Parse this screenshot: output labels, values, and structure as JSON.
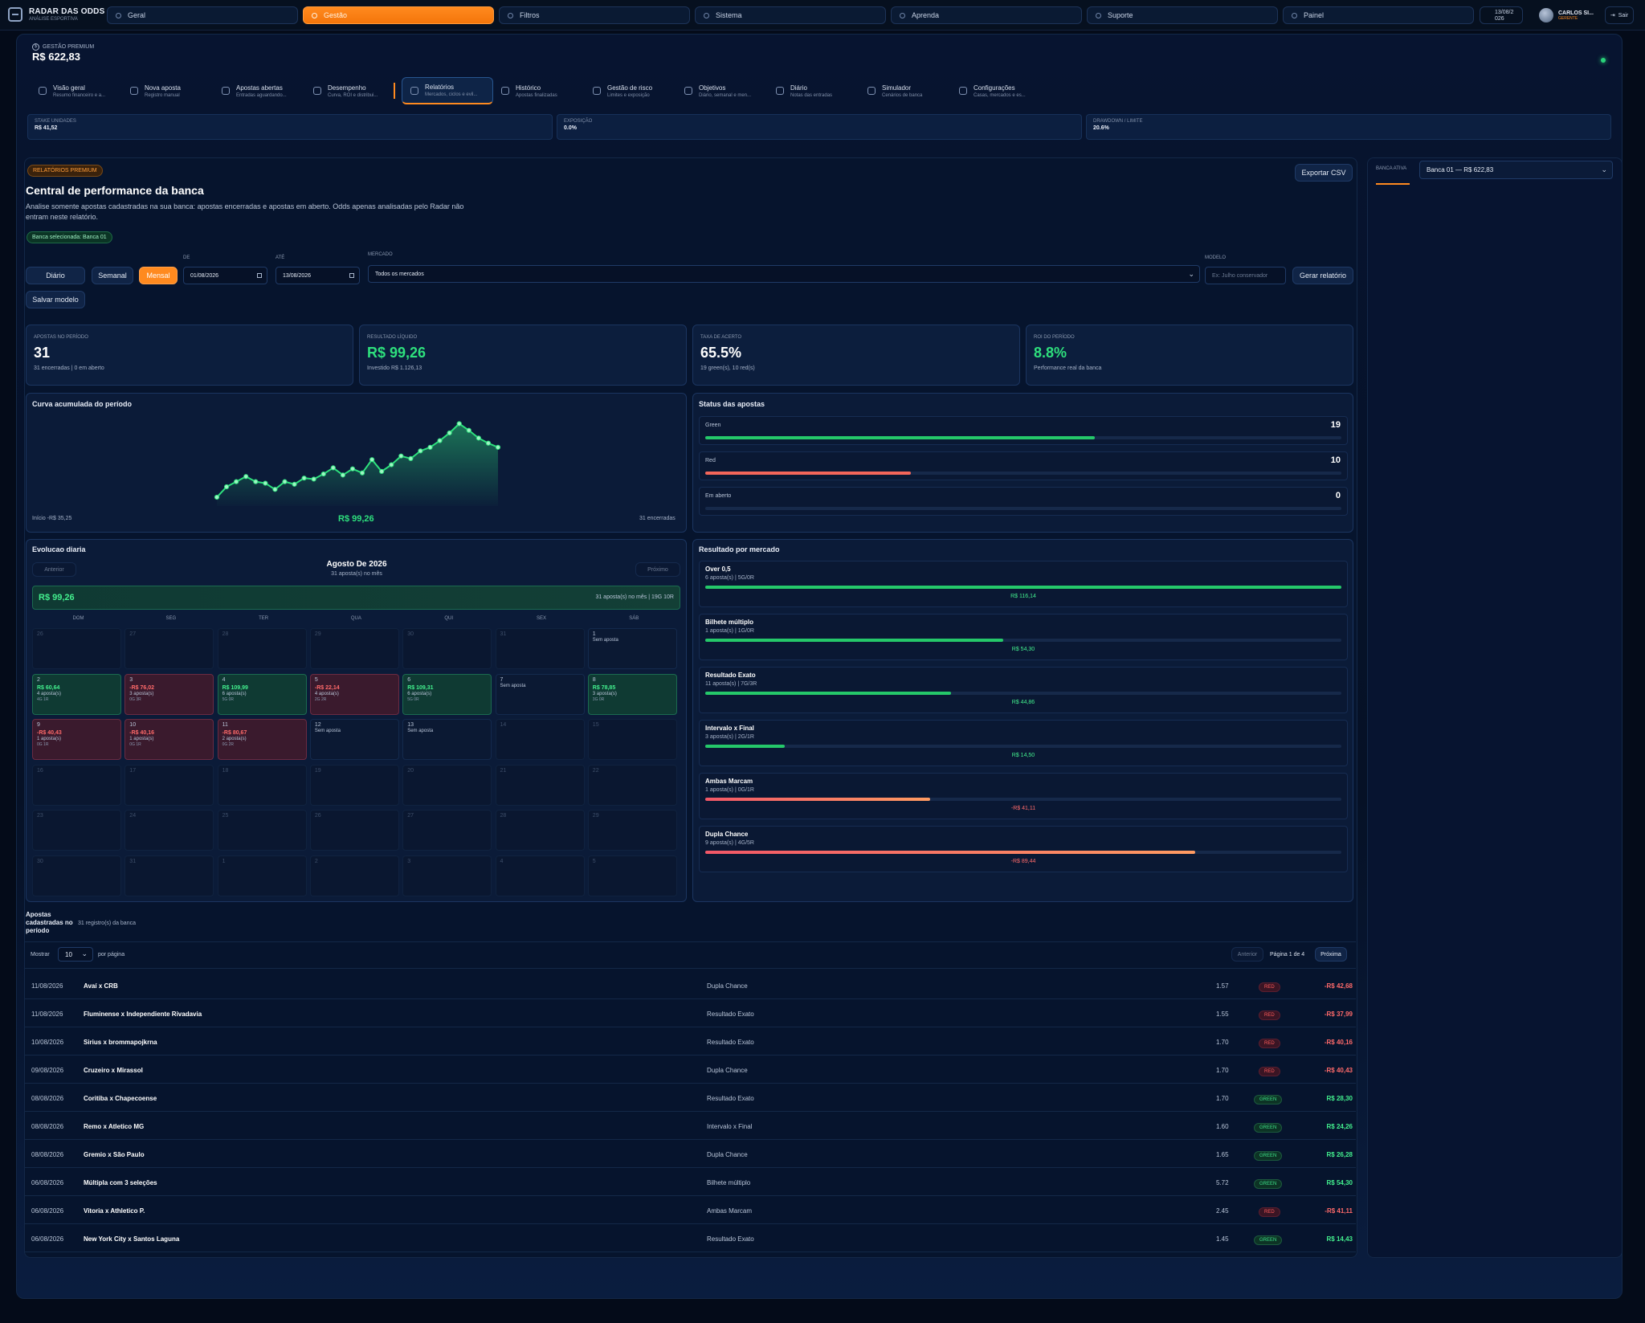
{
  "topbar": {
    "brand": "RADAR DAS ODDS",
    "brand_sub": "ANÁLISE ESPORTIVA",
    "tabs": [
      "Geral",
      "Gestão",
      "Filtros",
      "Sistema",
      "Aprenda",
      "Suporte",
      "Painel"
    ],
    "active_tab": "Gestão",
    "date_line1": "13/08/2",
    "date_line2": "026",
    "user_name": "CARLOS SI...",
    "user_role": "GERENTE",
    "logout": "Sair"
  },
  "header": {
    "label": "GESTÃO PREMIUM",
    "value": "R$ 622,83"
  },
  "subnav": [
    {
      "title": "Visão geral",
      "sub": "Resumo financeiro e a..."
    },
    {
      "title": "Nova aposta",
      "sub": "Registro manual"
    },
    {
      "title": "Apostas abertas",
      "sub": "Entradas aguardando..."
    },
    {
      "title": "Desempenho",
      "sub": "Curva, ROI e distribui..."
    },
    {
      "title": "Relatórios",
      "sub": "Mercados, ciclos e evil..."
    },
    {
      "title": "Histórico",
      "sub": "Apostas finalizadas"
    },
    {
      "title": "Gestão de risco",
      "sub": "Limites e exposição"
    },
    {
      "title": "Objetivos",
      "sub": "Diário, semanal e men..."
    },
    {
      "title": "Diário",
      "sub": "Notas das entradas"
    },
    {
      "title": "Simulador",
      "sub": "Cenários de banca"
    },
    {
      "title": "Configurações",
      "sub": "Casas, mercados e es..."
    }
  ],
  "stats": [
    {
      "label": "STAKE UNIDADES",
      "value": "R$ 41,52"
    },
    {
      "label": "EXPOSIÇÃO",
      "value": "0.0%"
    },
    {
      "label": "DRAWDOWN / LIMITE",
      "value": "20.6%"
    }
  ],
  "report": {
    "pill": "RELATÓRIOS PREMIUM",
    "title": "Central de performance da banca",
    "desc": "Analise somente apostas cadastradas na sua banca: apostas encerradas e apostas em aberto. Odds apenas analisadas pelo Radar não entram neste relatório.",
    "selected": "Banca selecionada: Banca 01",
    "export": "Exportar CSV"
  },
  "filters": {
    "daily": "Diário",
    "weekly": "Semanal",
    "monthly": "Mensal",
    "from_label": "DE",
    "from": "01/08/2026",
    "to_label": "ATÉ",
    "to": "13/08/2026",
    "market_label": "MERCADO",
    "market": "Todos os mercados",
    "model_label": "MODELO",
    "model_placeholder": "Ex: Julho conservador",
    "generate": "Gerar relatório",
    "save": "Salvar modelo"
  },
  "kpis": [
    {
      "label": "APOSTAS NO PERÍODO",
      "value": "31",
      "sub": "31 encerradas | 0 em aberto",
      "green": false
    },
    {
      "label": "RESULTADO LÍQUIDO",
      "value": "R$ 99,26",
      "sub": "Investido R$ 1.126,13",
      "green": true
    },
    {
      "label": "TAXA DE ACERTO",
      "value": "65.5%",
      "sub": "19 green(s), 10 red(s)",
      "green": false
    },
    {
      "label": "ROI DO PERÍODO",
      "value": "8.8%",
      "sub": "Performance real da banca",
      "green": true
    }
  ],
  "curve": {
    "title": "Curva acumulada do período",
    "start": "Início -R$ 35,25",
    "result": "R$ 99,26",
    "count": "31 encerradas"
  },
  "chart_data": {
    "type": "line",
    "title": "Curva acumulada do período",
    "values": [
      -35.25,
      -15,
      -5,
      5,
      -5,
      -8,
      -20,
      -5,
      -10,
      2,
      0,
      10,
      22,
      8,
      20,
      12,
      38,
      15,
      28,
      45,
      40,
      55,
      62,
      75,
      90,
      108,
      95,
      80,
      70,
      62
    ],
    "ylim": [
      -40,
      115
    ]
  },
  "status": {
    "title": "Status das apostas",
    "items": [
      {
        "label": "Green",
        "value": "19",
        "pct": 0.612,
        "color": "#25c86a"
      },
      {
        "label": "Red",
        "value": "10",
        "pct": 0.323,
        "color": "#f4665a"
      },
      {
        "label": "Em aberto",
        "value": "0",
        "pct": 0,
        "color": "#25c86a"
      }
    ]
  },
  "markets": {
    "title": "Resultado por mercado",
    "items": [
      {
        "name": "Over 0,5",
        "detail": "6 aposta(s) | 5G/0R",
        "amount": "R$ 116,14",
        "pct": 1.0,
        "pos": true
      },
      {
        "name": "Bilhete múltiplo",
        "detail": "1 aposta(s) | 1G/0R",
        "amount": "R$ 54,30",
        "pct": 0.468,
        "pos": true
      },
      {
        "name": "Resultado Exato",
        "detail": "11 aposta(s) | 7G/3R",
        "amount": "R$ 44,86",
        "pct": 0.386,
        "pos": true
      },
      {
        "name": "Intervalo x Final",
        "detail": "3 aposta(s) | 2G/1R",
        "amount": "R$ 14,50",
        "pct": 0.125,
        "pos": true
      },
      {
        "name": "Ambas Marcam",
        "detail": "1 aposta(s) | 0G/1R",
        "amount": "-R$ 41,11",
        "pct": 0.354,
        "pos": false
      },
      {
        "name": "Dupla Chance",
        "detail": "9 aposta(s) | 4G/5R",
        "amount": "-R$ 89,44",
        "pct": 0.77,
        "pos": false
      }
    ]
  },
  "calendar": {
    "title": "Evolucao diaria",
    "prev": "Anterior",
    "next": "Próximo",
    "month": "Agosto De 2026",
    "month_sub": "31 aposta(s) no mês",
    "total": "R$ 99,26",
    "total_sub": "31 aposta(s) no mês | 19G 10R",
    "weekdays": [
      "DOM",
      "SEG",
      "TER",
      "QUA",
      "QUI",
      "SEX",
      "SÁB"
    ],
    "cells": [
      {
        "d": "26",
        "out": true
      },
      {
        "d": "27",
        "out": true
      },
      {
        "d": "28",
        "out": true
      },
      {
        "d": "29",
        "out": true
      },
      {
        "d": "30",
        "out": true
      },
      {
        "d": "31",
        "out": true
      },
      {
        "d": "1",
        "s": "Sem aposta"
      },
      {
        "d": "2",
        "v": "R$ 60,64",
        "s": "4 aposta(s)",
        "m": "4G 1R",
        "t": "g"
      },
      {
        "d": "3",
        "v": "-R$ 76,02",
        "s": "3 aposta(s)",
        "m": "0G 3R",
        "t": "r"
      },
      {
        "d": "4",
        "v": "R$ 109,99",
        "s": "6 aposta(s)",
        "m": "5G 0R",
        "t": "g"
      },
      {
        "d": "5",
        "v": "-R$ 22,14",
        "s": "4 aposta(s)",
        "m": "2G 2R",
        "t": "r"
      },
      {
        "d": "6",
        "v": "R$ 109,31",
        "s": "6 aposta(s)",
        "m": "5G 0R",
        "t": "g"
      },
      {
        "d": "7",
        "s": "Sem aposta"
      },
      {
        "d": "8",
        "v": "R$ 78,85",
        "s": "3 aposta(s)",
        "m": "3G 0R",
        "t": "g"
      },
      {
        "d": "9",
        "v": "-R$ 40,43",
        "s": "1 aposta(s)",
        "m": "0G 1R",
        "t": "r"
      },
      {
        "d": "10",
        "v": "-R$ 40,16",
        "s": "1 aposta(s)",
        "m": "0G 1R",
        "t": "r"
      },
      {
        "d": "11",
        "v": "-R$ 80,67",
        "s": "2 aposta(s)",
        "m": "0G 2R",
        "t": "r"
      },
      {
        "d": "12",
        "s": "Sem aposta"
      },
      {
        "d": "13",
        "s": "Sem aposta"
      },
      {
        "d": "14",
        "out": true
      },
      {
        "d": "15",
        "out": true
      },
      {
        "d": "16",
        "out": true
      },
      {
        "d": "17",
        "out": true
      },
      {
        "d": "18",
        "out": true
      },
      {
        "d": "19",
        "out": true
      },
      {
        "d": "20",
        "out": true
      },
      {
        "d": "21",
        "out": true
      },
      {
        "d": "22",
        "out": true
      },
      {
        "d": "23",
        "out": true
      },
      {
        "d": "24",
        "out": true
      },
      {
        "d": "25",
        "out": true
      },
      {
        "d": "26",
        "out": true
      },
      {
        "d": "27",
        "out": true
      },
      {
        "d": "28",
        "out": true
      },
      {
        "d": "29",
        "out": true
      },
      {
        "d": "30",
        "out": true
      },
      {
        "d": "31",
        "out": true
      },
      {
        "d": "1",
        "out": true
      },
      {
        "d": "2",
        "out": true
      },
      {
        "d": "3",
        "out": true
      },
      {
        "d": "4",
        "out": true
      },
      {
        "d": "5",
        "out": true
      }
    ]
  },
  "bets": {
    "title": "Apostas cadastradas no período",
    "count": "31 registro(s) da banca",
    "show": "Mostrar",
    "per_page_value": "10",
    "per_page": "por página",
    "prev": "Anterior",
    "page": "Página 1 de 4",
    "next": "Próxima",
    "rows": [
      {
        "date": "11/08/2026",
        "event": "Avaí x CRB",
        "market": "Dupla Chance",
        "odd": "1.57",
        "status": "RED",
        "amount": "-R$ 42,68"
      },
      {
        "date": "11/08/2026",
        "event": "Fluminense x Independiente Rivadavia",
        "market": "Resultado Exato",
        "odd": "1.55",
        "status": "RED",
        "amount": "-R$ 37,99"
      },
      {
        "date": "10/08/2026",
        "event": "Sirius x brommapojkrna",
        "market": "Resultado Exato",
        "odd": "1.70",
        "status": "RED",
        "amount": "-R$ 40,16"
      },
      {
        "date": "09/08/2026",
        "event": "Cruzeiro x Mirassol",
        "market": "Dupla Chance",
        "odd": "1.70",
        "status": "RED",
        "amount": "-R$ 40,43"
      },
      {
        "date": "08/08/2026",
        "event": "Coritiba x Chapecoense",
        "market": "Resultado Exato",
        "odd": "1.70",
        "status": "GREEN",
        "amount": "R$ 28,30"
      },
      {
        "date": "08/08/2026",
        "event": "Remo x Atletico MG",
        "market": "Intervalo x Final",
        "odd": "1.60",
        "status": "GREEN",
        "amount": "R$ 24,26"
      },
      {
        "date": "08/08/2026",
        "event": "Gremio x São Paulo",
        "market": "Dupla Chance",
        "odd": "1.65",
        "status": "GREEN",
        "amount": "R$ 26,28"
      },
      {
        "date": "06/08/2026",
        "event": "Múltipla com 3 seleções",
        "market": "Bilhete múltiplo",
        "odd": "5.72",
        "status": "GREEN",
        "amount": "R$ 54,30"
      },
      {
        "date": "06/08/2026",
        "event": "Vitoria x Athletico P.",
        "market": "Ambas Marcam",
        "odd": "2.45",
        "status": "RED",
        "amount": "-R$ 41,11"
      },
      {
        "date": "06/08/2026",
        "event": "New York City x Santos Laguna",
        "market": "Resultado Exato",
        "odd": "1.45",
        "status": "GREEN",
        "amount": "R$ 14,43"
      }
    ]
  },
  "sidebar": {
    "label": "BANCA ATIVA",
    "value": "Banca 01 — R$ 622,83"
  }
}
